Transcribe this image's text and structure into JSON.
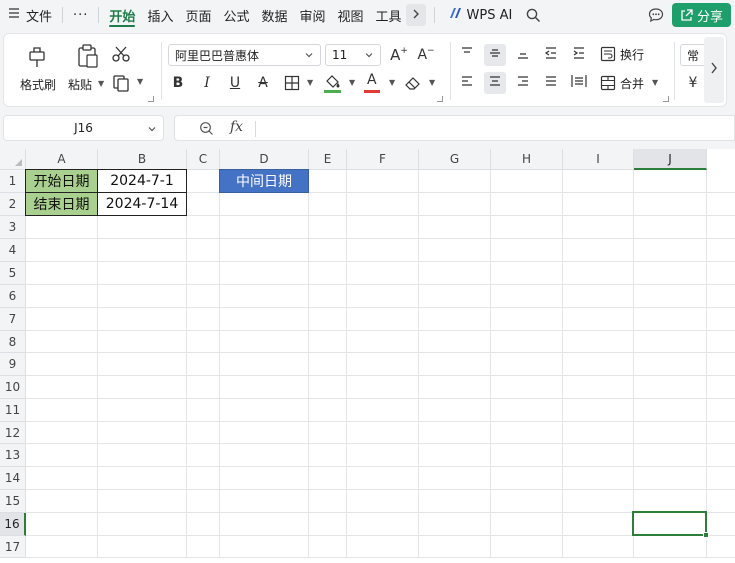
{
  "menu": {
    "items": [
      {
        "label": "文件",
        "name": "menu-file"
      },
      {
        "label": "开始",
        "name": "menu-home",
        "active": true
      },
      {
        "label": "插入",
        "name": "menu-insert"
      },
      {
        "label": "页面",
        "name": "menu-page"
      },
      {
        "label": "公式",
        "name": "menu-formula"
      },
      {
        "label": "数据",
        "name": "menu-data"
      },
      {
        "label": "审阅",
        "name": "menu-review"
      },
      {
        "label": "视图",
        "name": "menu-view"
      },
      {
        "label": "工具",
        "name": "menu-tools"
      }
    ],
    "more_label": "···",
    "wps_ai_label": "WPS AI",
    "share_label": "分享"
  },
  "ribbon": {
    "format_painter_label": "格式刷",
    "paste_label": "粘贴",
    "font_name": "阿里巴巴普惠体",
    "font_size": "11",
    "bold_label": "B",
    "italic_label": "I",
    "underline_label": "U",
    "strike_label": "A",
    "font_color_label": "A",
    "wrap_label": "换行",
    "merge_label": "合并",
    "number_format_label": "常",
    "currency_label": "¥",
    "grow_font_label": "A",
    "shrink_font_label": "A",
    "colors": {
      "fill": "#4caf50",
      "font": "#e53935",
      "accent": "#1e7c4a"
    }
  },
  "formula_bar": {
    "cell_ref": "J16",
    "fx_label": "fx",
    "value": ""
  },
  "sheet": {
    "columns": [
      "A",
      "B",
      "C",
      "D",
      "E",
      "F",
      "G",
      "H",
      "I",
      "J"
    ],
    "rows": [
      "1",
      "2",
      "3",
      "4",
      "5",
      "6",
      "7",
      "8",
      "9",
      "10",
      "11",
      "12",
      "13",
      "14",
      "15",
      "16",
      "17"
    ],
    "selected_column": "J",
    "selected_row": "16",
    "cells": {
      "A1": "开始日期",
      "B1": "2024-7-1",
      "A2": "结束日期",
      "B2": "2024-7-14",
      "D1": "中间日期"
    },
    "colors": {
      "label_fill": "#a9d08e",
      "header_fill": "#4472c4",
      "selection": "#2f7d3a"
    }
  }
}
